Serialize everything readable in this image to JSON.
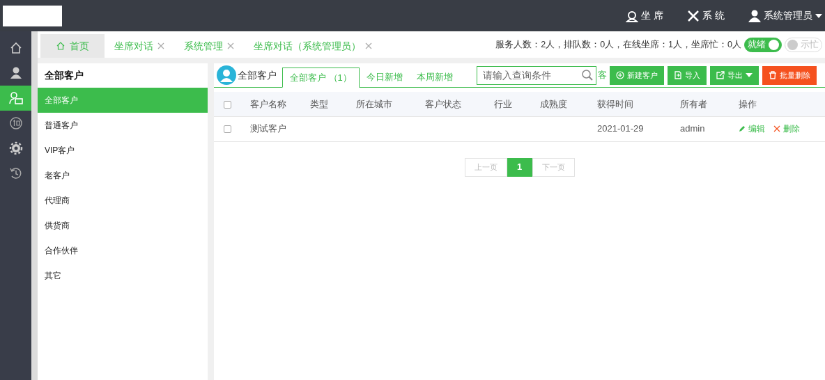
{
  "header": {
    "menu": [
      {
        "kind": "agent",
        "label": "坐 席"
      },
      {
        "kind": "system",
        "label": "系 统"
      },
      {
        "kind": "user",
        "label": "系统管理员"
      }
    ]
  },
  "rail": [
    {
      "kind": "home",
      "selected": false
    },
    {
      "kind": "person",
      "selected": false
    },
    {
      "kind": "customers",
      "selected": true
    },
    {
      "kind": "knowledge",
      "selected": false
    },
    {
      "kind": "settings",
      "selected": false
    },
    {
      "kind": "history",
      "selected": false
    }
  ],
  "page_tabs": [
    {
      "label": "首页",
      "selected": true,
      "closable": false
    },
    {
      "label": "坐席对话",
      "selected": false,
      "closable": true
    },
    {
      "label": "系统管理",
      "selected": false,
      "closable": true
    },
    {
      "label": "坐席对话（系统管理员）",
      "selected": false,
      "closable": true
    }
  ],
  "stats": "服务人数：2人，排队数：0人，在线坐席：1人，坐席忙：0人",
  "toggles": [
    {
      "label": "就绪",
      "on": true
    },
    {
      "label": "示忙",
      "on": false
    }
  ],
  "categories": {
    "title": "全部客户",
    "items": [
      {
        "label": "全部客户",
        "selected": true
      },
      {
        "label": "普通客户",
        "selected": false
      },
      {
        "label": "VIP客户",
        "selected": false
      },
      {
        "label": "老客户",
        "selected": false
      },
      {
        "label": "代理商",
        "selected": false
      },
      {
        "label": "供货商",
        "selected": false
      },
      {
        "label": "合作伙伴",
        "selected": false
      },
      {
        "label": "其它",
        "selected": false
      }
    ]
  },
  "main": {
    "title": "全部客户",
    "tabs": [
      {
        "label": "全部客户 （1）",
        "selected": true
      },
      {
        "label": "今日新增",
        "selected": false
      },
      {
        "label": "本周新增",
        "selected": false
      }
    ],
    "hidden_tab_fragment": "客",
    "search": {
      "placeholder": "请输入查询条件"
    },
    "buttons": [
      {
        "kind": "add",
        "label": "新建客户"
      },
      {
        "kind": "import",
        "label": "导入"
      },
      {
        "kind": "export",
        "label": "导出"
      },
      {
        "kind": "delete",
        "label": "批量删除"
      }
    ],
    "table": {
      "select_all": {
        "checked": false
      },
      "columns": [
        "客户名称",
        "类型",
        "所在城市",
        "客户状态",
        "行业",
        "成熟度",
        "获得时间",
        "所有者",
        "操作"
      ],
      "rows": [
        {
          "checked": false,
          "cells": [
            "测试客户",
            "",
            "",
            "",
            "",
            "",
            "2021-01-29",
            "admin"
          ],
          "actions": [
            "编辑",
            "删除"
          ]
        }
      ]
    },
    "pagination": {
      "prev": "上一页",
      "pages": [
        {
          "label": "1",
          "selected": true
        }
      ],
      "next": "下一页"
    }
  }
}
